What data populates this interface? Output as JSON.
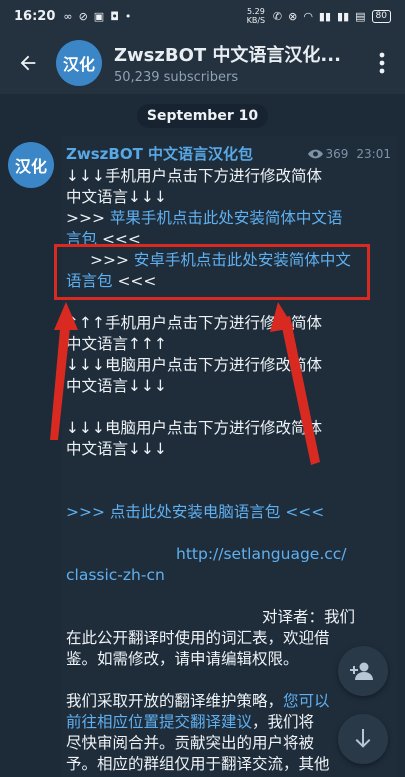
{
  "status_bar": {
    "time": "16:20",
    "net_speed": "5.29 KB/S",
    "battery": "80"
  },
  "header": {
    "avatar_text": "汉化",
    "title": "ZwszBOT 中文语言汉化...",
    "subtitle": "50,239 subscribers"
  },
  "date_divider": "September 10",
  "message": {
    "avatar_text": "汉化",
    "sender": "ZwszBOT 中文语言汉化包",
    "views": "369",
    "time": "23:01",
    "lines": {
      "l1": "↓↓↓手机用户点击下方进行修改简体",
      "l2": "中文语言↓↓↓",
      "l3_prefix": ">>> ",
      "l3_link": "苹果手机点击此处安装简体中文语",
      "l4_link": "言包",
      "l4_suffix": " <<<",
      "l5_prefix": ">>> ",
      "l5_link": "安卓手机点击此处安装简体中文",
      "l6_link": "语言包",
      "l6_suffix": " <<<",
      "l7": "↑↑↑手机用户点击下方进行修改简体",
      "l8": "中文语言↑↑↑",
      "l9": "↓↓↓电脑用户点击下方进行修改简体",
      "l10": "中文语言↓↓↓",
      "l11": "↓↓↓电脑用户点击下方进行修改简体",
      "l12": "中文语言↓↓↓",
      "l13_link": ">>> 点击此处安装电脑语言包 <<<",
      "l14_link": "http://setlanguage.cc/",
      "l15_link": "classic-zh-cn",
      "l16": "对译者：我们",
      "l17": "在此公开翻译时使用的词汇表，欢迎借",
      "l18": "鉴。如需修改，请申请编辑权限。",
      "l19_prefix": "我们采取开放的翻译维护策略，",
      "l19_link": "您可以",
      "l20_link": "前往相应位置提交翻译建议",
      "l20_suffix": "，我们将",
      "l21": "尽快审阅合并。贡献突出的用户将被",
      "l22": "予。相应的群组仅用于翻译交流，其他"
    }
  },
  "colors": {
    "background": "#1d2a37",
    "header": "#24313e",
    "accent_link": "#5fb0f0",
    "highlight_box": "#d92a22"
  },
  "icons": [
    "back-arrow-icon",
    "more-vertical-icon",
    "eye-icon",
    "add-user-icon",
    "arrow-down-icon"
  ]
}
